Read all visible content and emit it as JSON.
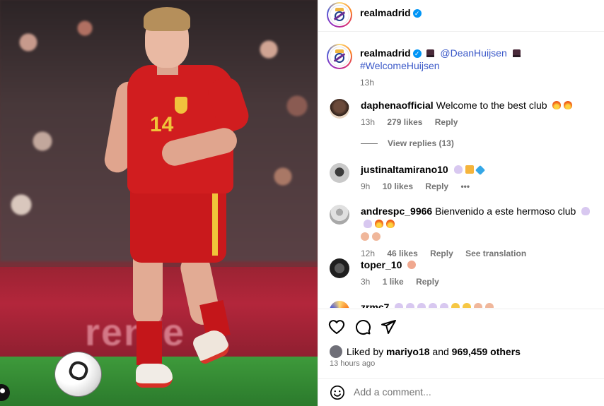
{
  "post": {
    "author": "realmadrid",
    "caption": {
      "mention": "@DeanHuijsen",
      "hashtag": "#WelcomeHuijsen",
      "time": "13h"
    }
  },
  "comments": [
    {
      "user": "daphenaofficial",
      "text": "Welcome to the best club",
      "time": "13h",
      "likes": "279 likes",
      "reply": "Reply",
      "view_replies": "View replies (13)"
    },
    {
      "user": "justinaltamirano10",
      "text": "",
      "time": "9h",
      "likes": "10 likes",
      "reply": "Reply",
      "more": "•••"
    },
    {
      "user": "andrespc_9966",
      "text": "Bienvenido a este hermoso club",
      "time": "12h",
      "likes": "46 likes",
      "reply": "Reply",
      "translate": "See translation"
    },
    {
      "user": "toper_10",
      "text": "",
      "time": "3h",
      "likes": "1 like",
      "reply": "Reply"
    },
    {
      "user": "zrmc7",
      "text": ""
    }
  ],
  "engagement": {
    "liked_by_prefix": "Liked by",
    "liked_by_user": "mariyo18",
    "and": "and",
    "others": "969,459 others",
    "time_ago": "13 hours ago"
  },
  "add_comment": {
    "placeholder": "Add a comment..."
  },
  "photo": {
    "ad_text": "renfe",
    "jersey_number": "14"
  },
  "colors": {
    "link": "#3a58c8",
    "verified": "#0095f6",
    "muted": "#737373"
  }
}
